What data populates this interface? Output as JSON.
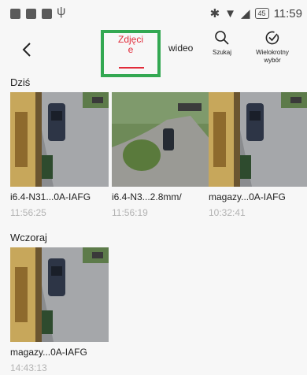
{
  "status_bar": {
    "battery": "45",
    "time": "11:59"
  },
  "header": {
    "tabs": [
      {
        "label": "Zdjęci\ne",
        "active": true
      },
      {
        "label": "wideo",
        "active": false
      }
    ],
    "search_label": "Szukaj",
    "multi_select_label": "Wielokrotny\nwybór"
  },
  "accent_color": "#e12b3a",
  "highlight_color": "#33a852",
  "sections": [
    {
      "label": "Dziś",
      "items": [
        {
          "name": "i6.4-N31...0A-IAFG",
          "time": "11:56:25",
          "scene": "house-driveway"
        },
        {
          "name": "i6.4-N3...2.8mm/",
          "time": "11:56:19",
          "scene": "garden-driveway"
        },
        {
          "name": "magazy...0A-IAFG",
          "time": "10:32:41",
          "scene": "house-driveway"
        }
      ]
    },
    {
      "label": "Wczoraj",
      "items": [
        {
          "name": "magazy...0A-IAFG",
          "time": "14:43:13",
          "scene": "house-driveway"
        }
      ]
    }
  ]
}
